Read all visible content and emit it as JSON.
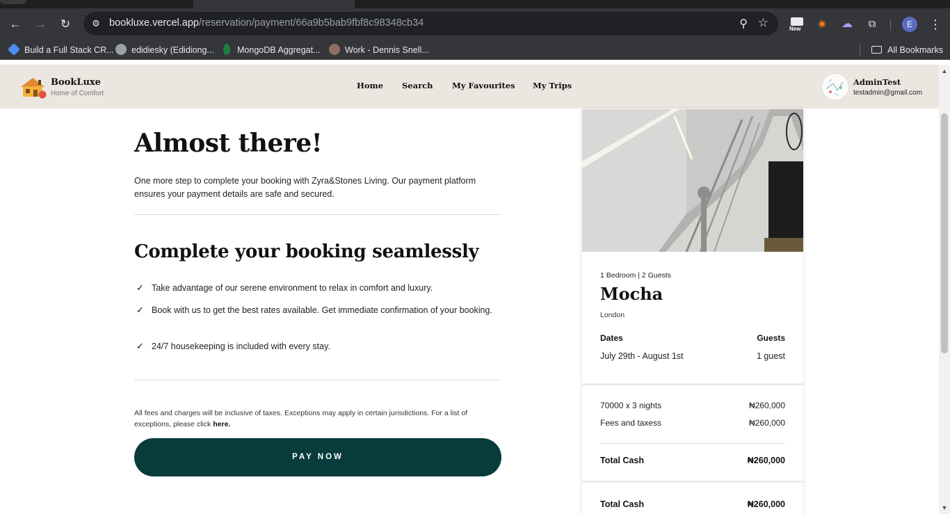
{
  "browser": {
    "url_host": "bookluxe.vercel.app",
    "url_path": "/reservation/payment/66a9b5bab9fbf8c98348cb34",
    "new_badge": "New",
    "profile_initial": "E",
    "bookmarks": [
      {
        "label": "Build a Full Stack CR...",
        "icon": "diamond-icon"
      },
      {
        "label": "edidiesky (Edidiong...",
        "icon": "github-icon"
      },
      {
        "label": "MongoDB Aggregat...",
        "icon": "mongodb-leaf-icon"
      },
      {
        "label": "Work - Dennis Snell...",
        "icon": "avatar-icon"
      }
    ],
    "all_bookmarks": "All Bookmarks"
  },
  "site": {
    "brand": "BookLuxe",
    "tagline": "Home of Comfort",
    "nav": [
      "Home",
      "Search",
      "My Favourites",
      "My Trips"
    ],
    "user_name": "AdminTest",
    "user_email": "testadmin@gmail.com"
  },
  "main": {
    "title": "Almost there!",
    "intro": "One more step to complete your booking with Zyra&Stones Living. Our payment platform ensures your payment details are safe and secured.",
    "subtitle": "Complete your booking seamlessly",
    "bullets": [
      "Take advantage of our serene environment to relax in comfort and luxury.",
      "Book with us to get the best rates available. Get immediate confirmation of your booking.",
      "24/7 housekeeping is included with every stay."
    ],
    "fees_note": "All fees and charges will be inclusive of taxes. Exceptions may apply in certain jurisdictions. For a list of exceptions, please click",
    "fees_link": "here.",
    "pay_button": "PAY NOW"
  },
  "card": {
    "meta": "1 Bedroom | 2 Guests",
    "title": "Mocha",
    "city": "London",
    "dates_label": "Dates",
    "dates_value": "July 29th - August 1st",
    "guests_label": "Guests",
    "guests_value": "1 guest",
    "nights_label": "70000 x 3 nights",
    "nights_amount": "₦260,000",
    "fees_label": "Fees and taxess",
    "fees_amount": "₦260,000",
    "total_label": "Total Cash",
    "total_amount": "₦260,000",
    "total2_label": "Total Cash",
    "total2_amount": "₦260,000"
  },
  "colors": {
    "header_bg": "#ece6e0",
    "pay_button": "#083b3c"
  }
}
